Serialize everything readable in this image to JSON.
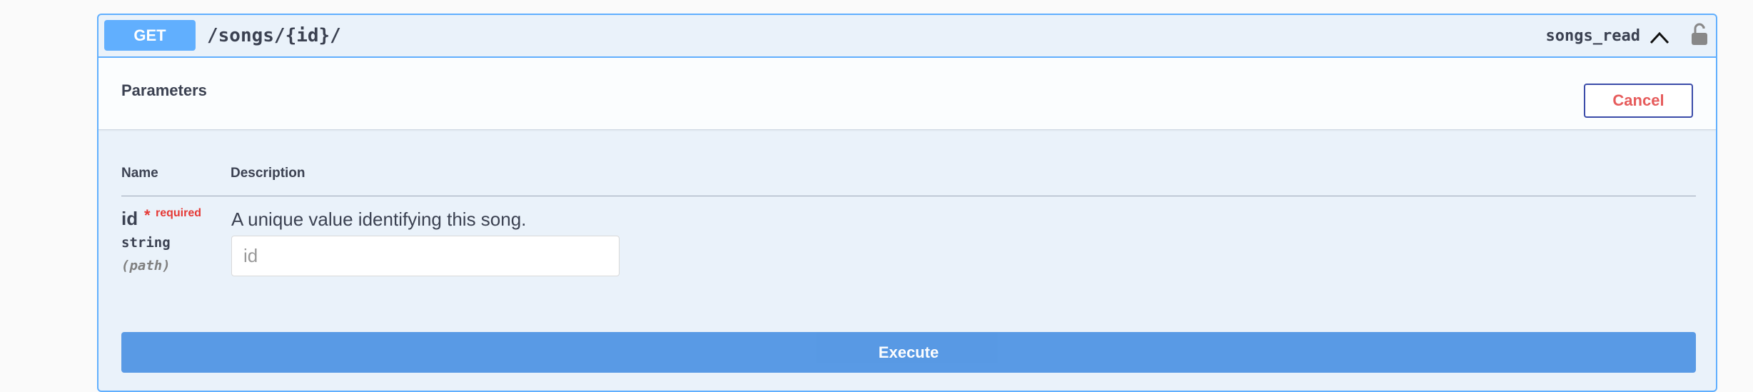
{
  "operation": {
    "method": "GET",
    "path": "/songs/{id}/",
    "operation_id": "songs_read"
  },
  "icons": {
    "collapse": "chevron-up-icon",
    "auth": "unlocked-padlock-icon"
  },
  "parameters_section": {
    "title": "Parameters",
    "cancel_label": "Cancel",
    "columns": {
      "name": "Name",
      "description": "Description"
    },
    "params": [
      {
        "name": "id",
        "required_star": "*",
        "required_label": "required",
        "type": "string",
        "in": "(path)",
        "description": "A unique value identifying this song.",
        "value": "",
        "placeholder": "id"
      }
    ]
  },
  "execute_label": "Execute",
  "colors": {
    "get_accent": "#61affe",
    "execute": "#4990e2",
    "cancel_text": "#e65b5b",
    "cancel_border": "#3b4ca9",
    "required": "#e53935"
  }
}
